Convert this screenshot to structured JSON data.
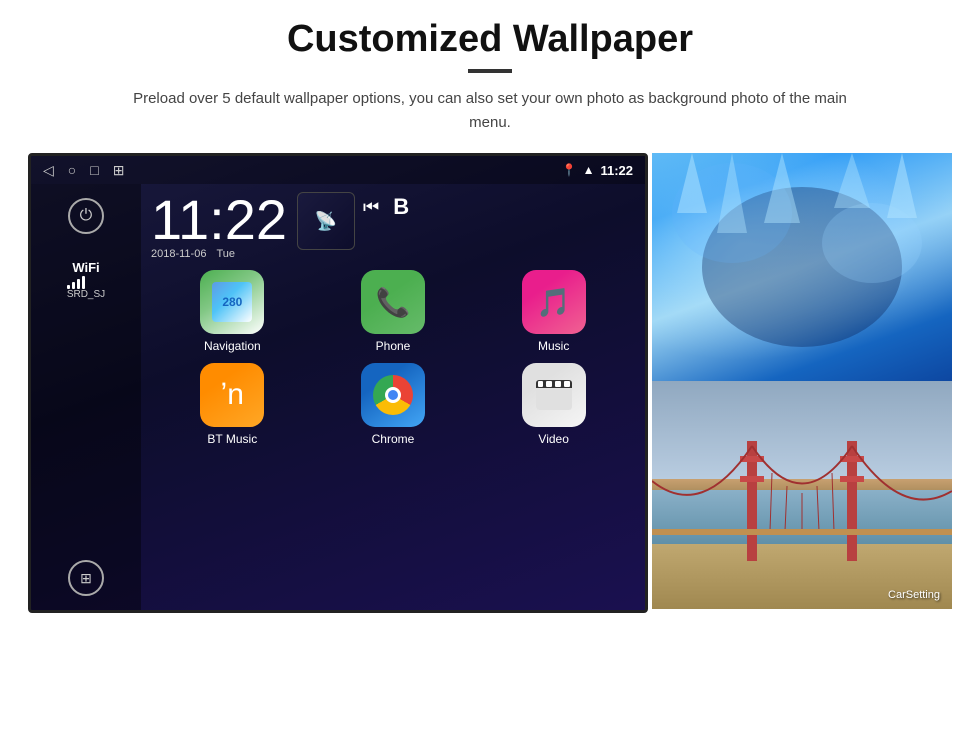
{
  "page": {
    "title": "Customized Wallpaper",
    "description": "Preload over 5 default wallpaper options, you can also set your own photo as background photo of the main menu."
  },
  "android_screen": {
    "time": "11:22",
    "date": "2018-11-06",
    "day": "Tue",
    "wifi_label": "WiFi",
    "wifi_ssid": "SRD_SJ",
    "apps": [
      {
        "name": "Navigation",
        "type": "navigation"
      },
      {
        "name": "Phone",
        "type": "phone"
      },
      {
        "name": "Music",
        "type": "music"
      },
      {
        "name": "BT Music",
        "type": "bt-music"
      },
      {
        "name": "Chrome",
        "type": "chrome"
      },
      {
        "name": "Video",
        "type": "video"
      }
    ],
    "car_setting_label": "CarSetting"
  }
}
